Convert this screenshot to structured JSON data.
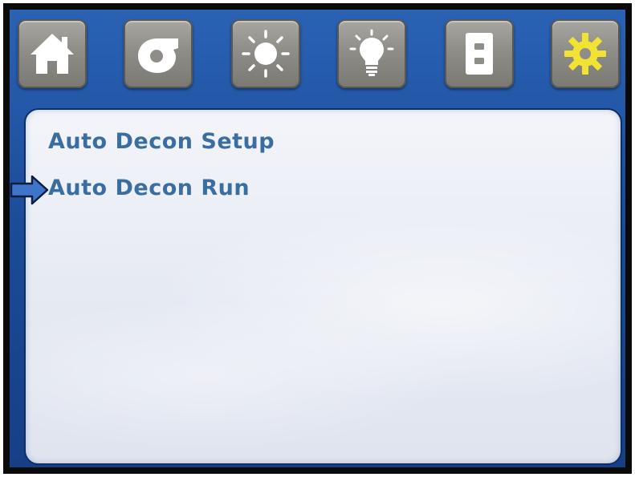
{
  "toolbar": {
    "buttons": [
      {
        "id": "home",
        "icon": "home-icon"
      },
      {
        "id": "blower",
        "icon": "blower-icon"
      },
      {
        "id": "uv-light",
        "icon": "sun-icon"
      },
      {
        "id": "light",
        "icon": "lightbulb-icon"
      },
      {
        "id": "outlet",
        "icon": "outlet-icon"
      },
      {
        "id": "settings",
        "icon": "gear-icon",
        "active_color": "#f2e234"
      }
    ]
  },
  "menu": {
    "items": [
      {
        "label": "Auto Decon Setup"
      },
      {
        "label": "Auto Decon Run"
      }
    ],
    "selected_index": 1
  },
  "colors": {
    "frame_blue": "#1d4e9c",
    "menu_text": "#3a6ea0",
    "arrow_fill": "#3f74c8",
    "icon_white": "#ffffff",
    "gear_yellow": "#f2e234"
  }
}
